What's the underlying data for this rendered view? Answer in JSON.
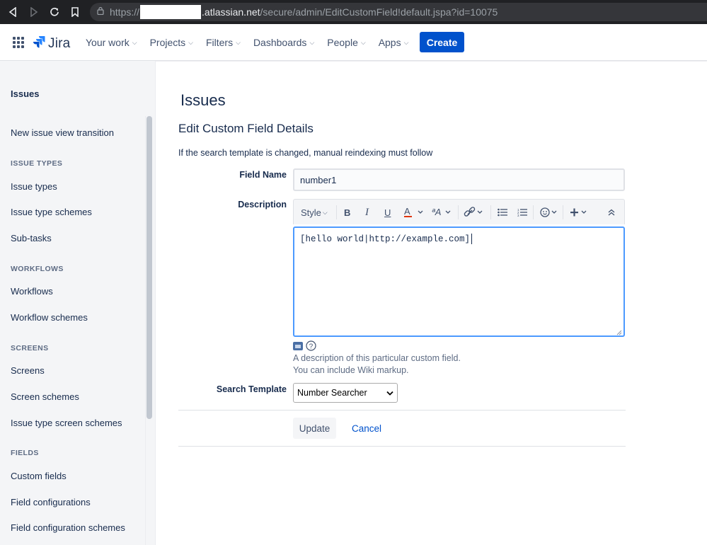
{
  "browser": {
    "url_prefix": "https://",
    "url_host": ".atlassian.net",
    "url_path": "/secure/admin/EditCustomField!default.jspa?id=10075"
  },
  "topnav": {
    "logo_text": "Jira",
    "menu": [
      {
        "label": "Your work"
      },
      {
        "label": "Projects"
      },
      {
        "label": "Filters"
      },
      {
        "label": "Dashboards"
      },
      {
        "label": "People"
      },
      {
        "label": "Apps"
      }
    ],
    "create_label": "Create",
    "brand_color": "#0052cc"
  },
  "sidebar": {
    "heading": "Issues",
    "items": [
      {
        "label": "New issue view transition"
      },
      {
        "section": "ISSUE TYPES"
      },
      {
        "label": "Issue types"
      },
      {
        "label": "Issue type schemes"
      },
      {
        "label": "Sub-tasks"
      },
      {
        "section": "WORKFLOWS"
      },
      {
        "label": "Workflows"
      },
      {
        "label": "Workflow schemes"
      },
      {
        "section": "SCREENS"
      },
      {
        "label": "Screens"
      },
      {
        "label": "Screen schemes"
      },
      {
        "label": "Issue type screen schemes"
      },
      {
        "section": "FIELDS"
      },
      {
        "label": "Custom fields"
      },
      {
        "label": "Field configurations"
      },
      {
        "label": "Field configuration schemes"
      }
    ]
  },
  "main": {
    "title": "Issues",
    "subtitle": "Edit Custom Field Details",
    "notice": "If the search template is changed, manual reindexing must follow",
    "field_name_label": "Field Name",
    "field_name_value": "number1",
    "description_label": "Description",
    "toolbar": {
      "style_label": "Style"
    },
    "description_value": "[hello world|http://example.com]",
    "description_help_1": "A description of this particular custom field.",
    "description_help_2": "You can include Wiki markup.",
    "search_template_label": "Search Template",
    "search_template_value": "Number Searcher",
    "update_label": "Update",
    "cancel_label": "Cancel"
  }
}
